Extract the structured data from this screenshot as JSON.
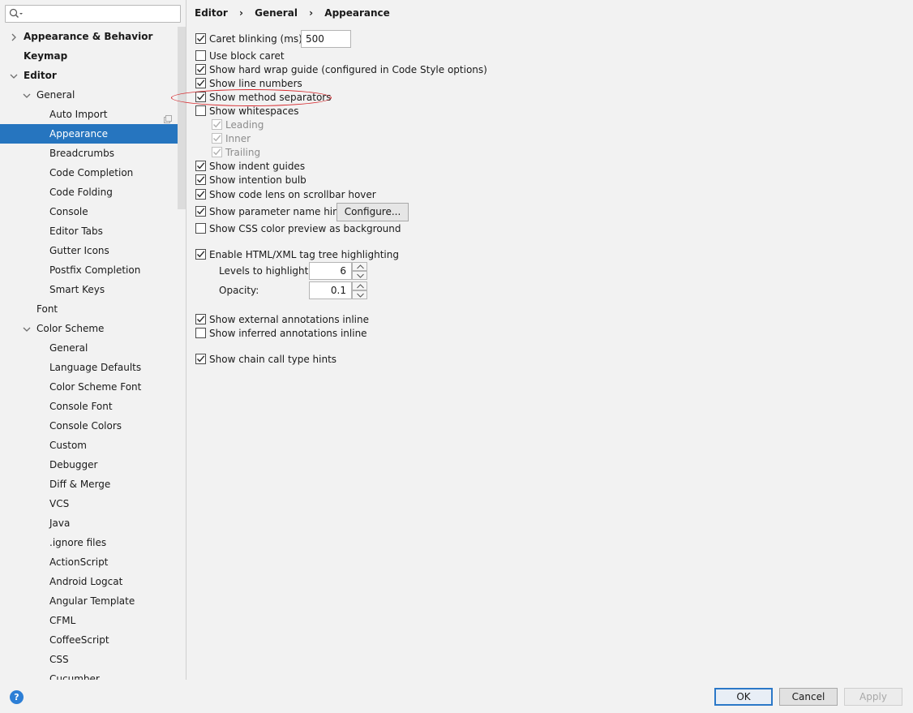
{
  "search": {
    "placeholder": "",
    "value": ""
  },
  "sidebar": {
    "items": [
      {
        "label": "Appearance & Behavior",
        "bold": true,
        "arrow": "right",
        "indent": 0
      },
      {
        "label": "Keymap",
        "bold": true,
        "arrow": "",
        "indent": 0
      },
      {
        "label": "Editor",
        "bold": true,
        "arrow": "down",
        "indent": 0
      },
      {
        "label": "General",
        "bold": false,
        "arrow": "down",
        "indent": 1
      },
      {
        "label": "Auto Import",
        "bold": false,
        "arrow": "",
        "indent": 2,
        "copy": true
      },
      {
        "label": "Appearance",
        "bold": false,
        "arrow": "",
        "indent": 2,
        "selected": true
      },
      {
        "label": "Breadcrumbs",
        "bold": false,
        "arrow": "",
        "indent": 2
      },
      {
        "label": "Code Completion",
        "bold": false,
        "arrow": "",
        "indent": 2
      },
      {
        "label": "Code Folding",
        "bold": false,
        "arrow": "",
        "indent": 2
      },
      {
        "label": "Console",
        "bold": false,
        "arrow": "",
        "indent": 2
      },
      {
        "label": "Editor Tabs",
        "bold": false,
        "arrow": "",
        "indent": 2
      },
      {
        "label": "Gutter Icons",
        "bold": false,
        "arrow": "",
        "indent": 2
      },
      {
        "label": "Postfix Completion",
        "bold": false,
        "arrow": "",
        "indent": 2
      },
      {
        "label": "Smart Keys",
        "bold": false,
        "arrow": "",
        "indent": 2
      },
      {
        "label": "Font",
        "bold": false,
        "arrow": "",
        "indent": 1
      },
      {
        "label": "Color Scheme",
        "bold": false,
        "arrow": "down",
        "indent": 1
      },
      {
        "label": "General",
        "bold": false,
        "arrow": "",
        "indent": 2
      },
      {
        "label": "Language Defaults",
        "bold": false,
        "arrow": "",
        "indent": 2
      },
      {
        "label": "Color Scheme Font",
        "bold": false,
        "arrow": "",
        "indent": 2
      },
      {
        "label": "Console Font",
        "bold": false,
        "arrow": "",
        "indent": 2
      },
      {
        "label": "Console Colors",
        "bold": false,
        "arrow": "",
        "indent": 2
      },
      {
        "label": "Custom",
        "bold": false,
        "arrow": "",
        "indent": 2
      },
      {
        "label": "Debugger",
        "bold": false,
        "arrow": "",
        "indent": 2
      },
      {
        "label": "Diff & Merge",
        "bold": false,
        "arrow": "",
        "indent": 2
      },
      {
        "label": "VCS",
        "bold": false,
        "arrow": "",
        "indent": 2
      },
      {
        "label": "Java",
        "bold": false,
        "arrow": "",
        "indent": 2
      },
      {
        "label": ".ignore files",
        "bold": false,
        "arrow": "",
        "indent": 2
      },
      {
        "label": "ActionScript",
        "bold": false,
        "arrow": "",
        "indent": 2
      },
      {
        "label": "Android Logcat",
        "bold": false,
        "arrow": "",
        "indent": 2
      },
      {
        "label": "Angular Template",
        "bold": false,
        "arrow": "",
        "indent": 2
      },
      {
        "label": "CFML",
        "bold": false,
        "arrow": "",
        "indent": 2
      },
      {
        "label": "CoffeeScript",
        "bold": false,
        "arrow": "",
        "indent": 2
      },
      {
        "label": "CSS",
        "bold": false,
        "arrow": "",
        "indent": 2
      },
      {
        "label": "Cucumber",
        "bold": false,
        "arrow": "",
        "indent": 2
      }
    ]
  },
  "breadcrumb": {
    "part1": "Editor",
    "part2": "General",
    "part3": "Appearance",
    "separator": "›"
  },
  "options": {
    "caret_blinking": {
      "label": "Caret blinking (ms):",
      "checked": true,
      "value": "500"
    },
    "block_caret": {
      "label": "Use block caret",
      "checked": false
    },
    "hard_wrap": {
      "label": "Show hard wrap guide (configured in Code Style options)",
      "checked": true
    },
    "line_numbers": {
      "label": "Show line numbers",
      "checked": true
    },
    "method_separators": {
      "label": "Show method separators",
      "checked": true
    },
    "whitespaces": {
      "label": "Show whitespaces",
      "checked": false
    },
    "leading": {
      "label": "Leading",
      "checked": true,
      "disabled": true
    },
    "inner": {
      "label": "Inner",
      "checked": true,
      "disabled": true
    },
    "trailing": {
      "label": "Trailing",
      "checked": true,
      "disabled": true
    },
    "indent_guides": {
      "label": "Show indent guides",
      "checked": true
    },
    "intention_bulb": {
      "label": "Show intention bulb",
      "checked": true
    },
    "code_lens": {
      "label": "Show code lens on scrollbar hover",
      "checked": true
    },
    "param_hints": {
      "label": "Show parameter name hints",
      "checked": true,
      "button": "Configure..."
    },
    "css_preview": {
      "label": "Show CSS color preview as background",
      "checked": false
    },
    "tag_tree": {
      "label": "Enable HTML/XML tag tree highlighting",
      "checked": true
    },
    "levels": {
      "label": "Levels to highlight:",
      "value": "6"
    },
    "opacity": {
      "label": "Opacity:",
      "value": "0.1"
    },
    "external_annotations": {
      "label": "Show external annotations inline",
      "checked": true
    },
    "inferred_annotations": {
      "label": "Show inferred annotations inline",
      "checked": false
    },
    "chain_call_hints": {
      "label": "Show chain call type hints",
      "checked": true
    }
  },
  "footer": {
    "help": "?",
    "ok": "OK",
    "cancel": "Cancel",
    "apply": "Apply"
  },
  "colors": {
    "selection": "#2675bf",
    "annotation_oval": "#d6262a",
    "ok_border": "#2b78c8"
  }
}
